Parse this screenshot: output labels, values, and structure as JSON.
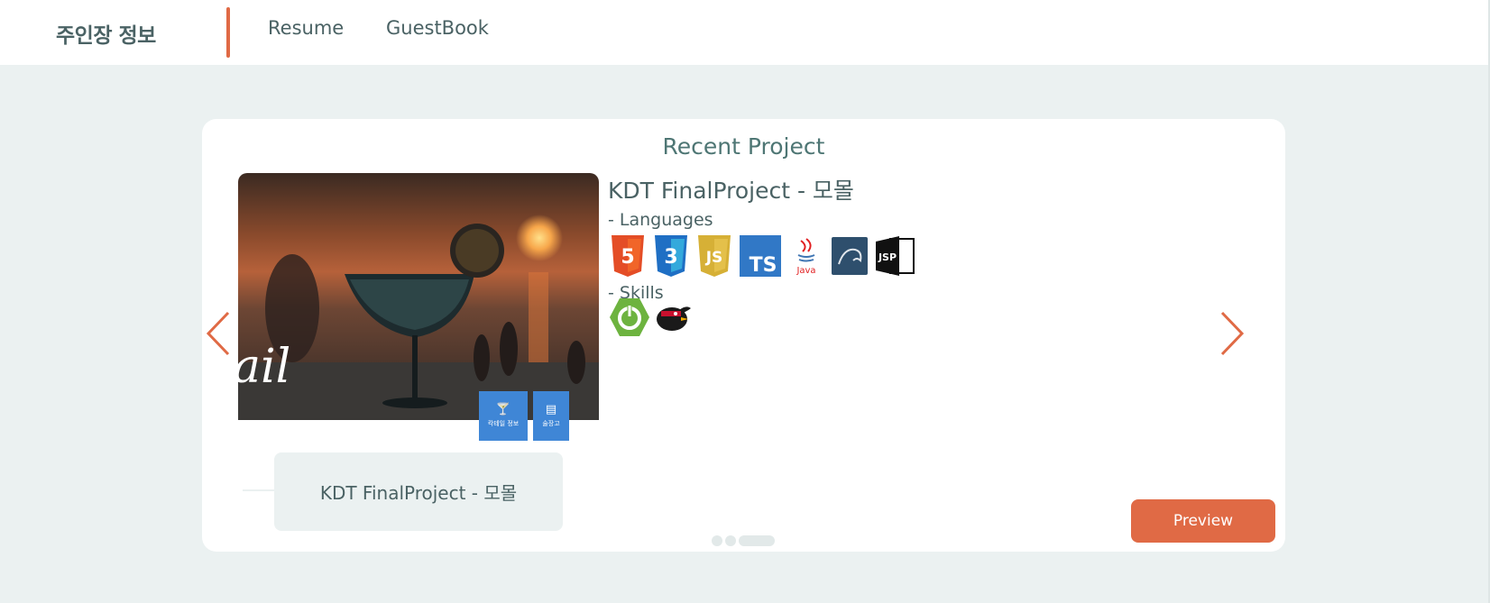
{
  "header": {
    "brand": "주인장 정보",
    "nav": [
      {
        "label": "Resume"
      },
      {
        "label": "GuestBook"
      }
    ]
  },
  "card": {
    "title": "Recent Project",
    "project": {
      "title": "KDT FinalProject - 모몰",
      "languages_label": "- Languages",
      "languages": [
        {
          "icon": "html5-icon",
          "label": "5",
          "color": "#e44d26"
        },
        {
          "icon": "css3-icon",
          "label": "3",
          "color": "#1f6fc4"
        },
        {
          "icon": "javascript-icon",
          "label": "JS",
          "color": "#d6b036"
        },
        {
          "icon": "typescript-icon",
          "label": "TS",
          "color": "#3178c6"
        },
        {
          "icon": "java-icon",
          "label": "Java",
          "color": "#e11f21"
        },
        {
          "icon": "mysql-icon",
          "label": "",
          "color": "#2e4f6d"
        },
        {
          "icon": "jsp-icon",
          "label": "JSP",
          "color": "#111111"
        }
      ],
      "skills_label": "- Skills",
      "skills": [
        {
          "icon": "spring-boot-icon",
          "color": "#6db33f"
        },
        {
          "icon": "ninja-bird-icon",
          "color": "#1a1a1a"
        }
      ],
      "image_text": "ail",
      "image_buttons": [
        {
          "icon": "cocktail-icon",
          "label": "칵테일 정보"
        },
        {
          "icon": "fridge-icon",
          "label": "술장고"
        }
      ]
    },
    "thumbnail_label": "KDT FinalProject - 모몰",
    "preview_label": "Preview",
    "pagination": {
      "count": 3,
      "active": 3
    }
  },
  "colors": {
    "accent": "#e06a45",
    "background": "#ebf1f1",
    "text": "#4a6264",
    "button_blue": "#3f86d6"
  }
}
